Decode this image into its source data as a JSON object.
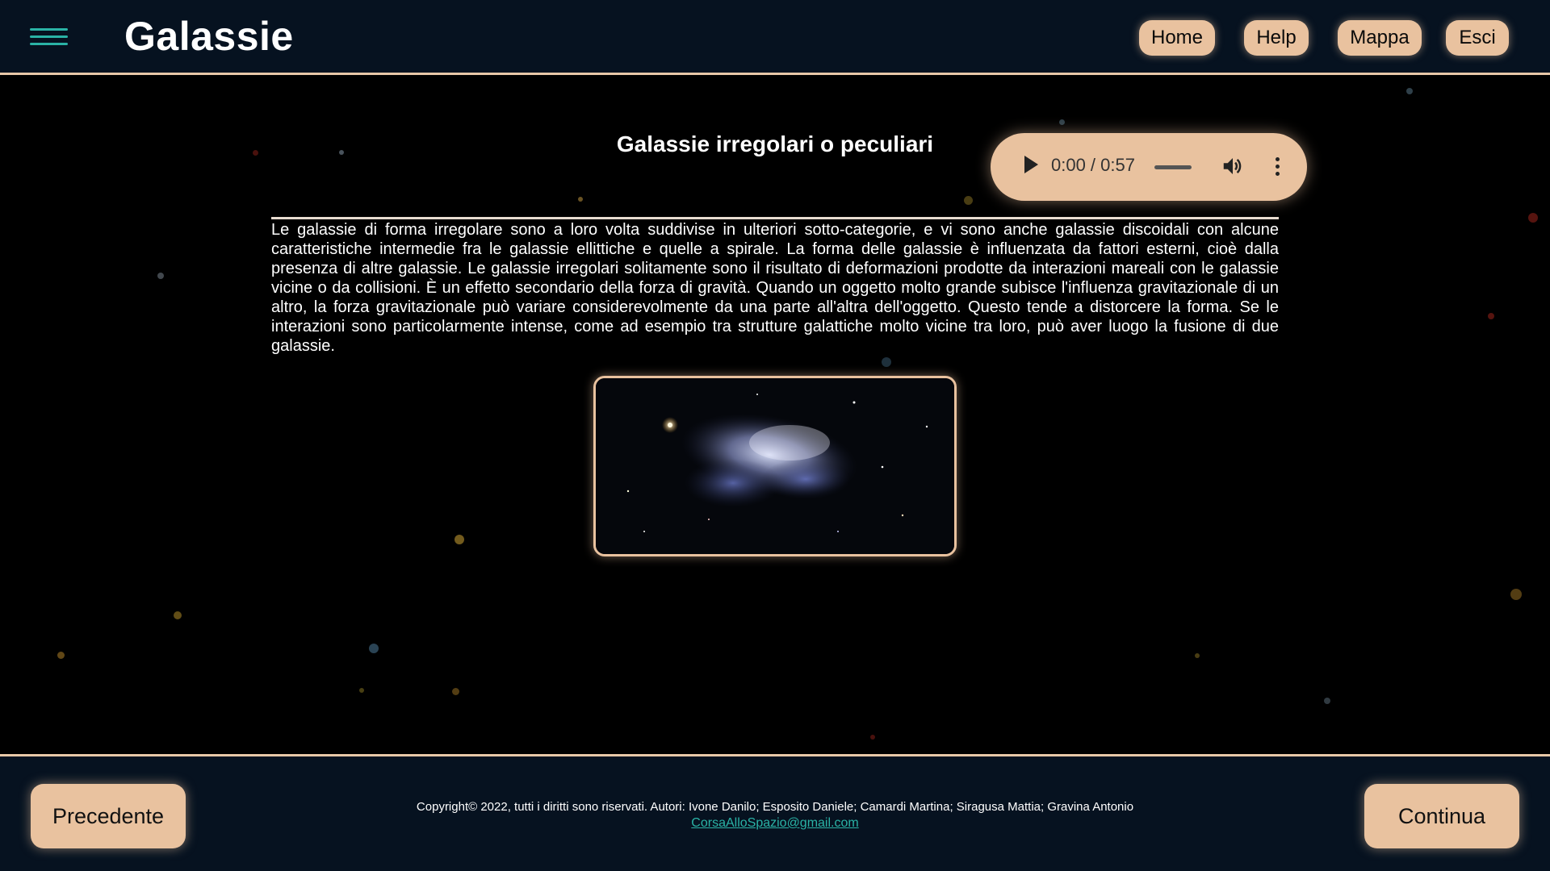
{
  "header": {
    "menu_icon": "hamburger-icon",
    "title": "Galassie",
    "nav": [
      {
        "label": "Home"
      },
      {
        "label": "Help"
      },
      {
        "label": "Mappa"
      },
      {
        "label": "Esci"
      }
    ]
  },
  "main": {
    "section_title": "Galassie irregolari o peculiari",
    "audio": {
      "time": "0:00 / 0:57",
      "play_icon": "play-icon",
      "volume_icon": "volume-icon",
      "more_icon": "more-vertical-icon"
    },
    "paragraph": "Le galassie di forma irregolare sono a loro volta suddivise in ulteriori sotto-categorie, e vi sono anche galassie discoidali con alcune caratteristiche intermedie fra le galassie ellittiche e quelle a spirale. La forma delle galassie è influenzata da fattori esterni, cioè dalla presenza di altre galassie. Le galassie irregolari solitamente sono il risultato di deformazioni prodotte da interazioni mareali con le galassie vicine o da collisioni. È un effetto secondario della forza di gravità. Quando un oggetto molto grande subisce l'influenza gravitazionale di un altro, la forza gravitazionale può variare considerevolmente da una parte all'altra dell'oggetto. Questo tende a distorcere la forma. Se le interazioni sono particolarmente intense, come ad esempio tra strutture galattiche molto vicine tra loro, può aver luogo la fusione di due galassie."
  },
  "footer": {
    "prev_label": "Precedente",
    "next_label": "Continua",
    "copyright": "Copyright© 2022, tutti i diritti sono riservati. Autori: Ivone Danilo; Esposito Daniele; Camardi Martina; Siragusa Mattia; Gravina Antonio",
    "email": "CorsaAlloSpazio@gmail.com"
  },
  "colors": {
    "bar_bg": "#061220",
    "accent": "#e9c29f",
    "teal": "#2ab3a6"
  }
}
